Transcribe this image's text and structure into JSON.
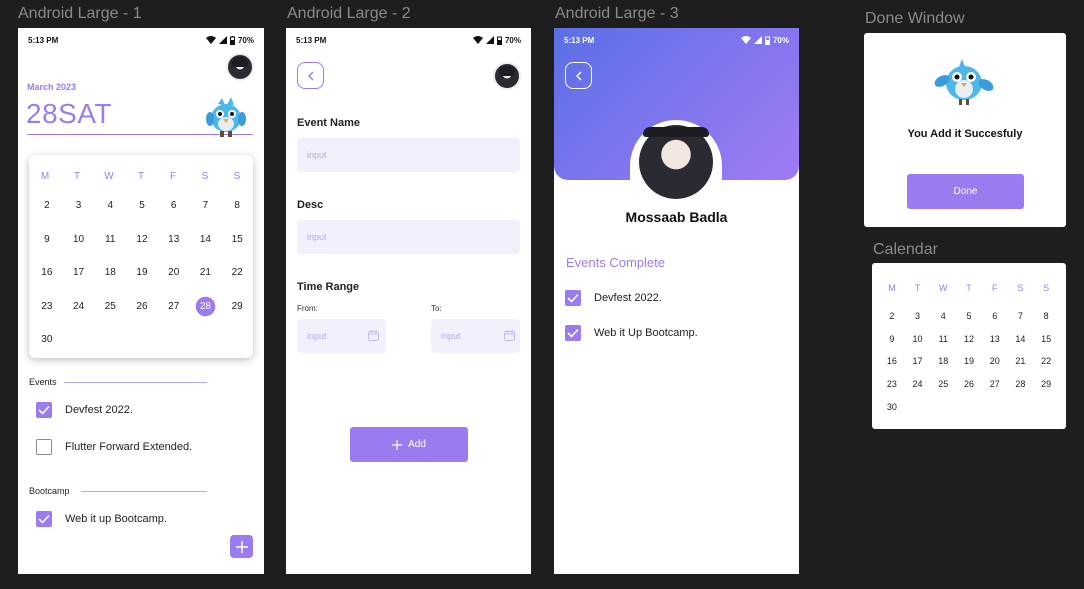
{
  "frames": {
    "f1": "Android Large - 1",
    "f2": "Android Large - 2",
    "f3": "Android Large - 3",
    "done": "Done Window",
    "calendar": "Calendar"
  },
  "status": {
    "time": "5:13 PM",
    "battery": "70%"
  },
  "screen1": {
    "month": "March 2023",
    "date": "28SAT",
    "weekdays": [
      "M",
      "T",
      "W",
      "T",
      "F",
      "S",
      "S"
    ],
    "days": [
      "2",
      "3",
      "4",
      "5",
      "6",
      "7",
      "8",
      "9",
      "10",
      "11",
      "12",
      "13",
      "14",
      "15",
      "16",
      "17",
      "18",
      "19",
      "20",
      "21",
      "22",
      "23",
      "24",
      "25",
      "26",
      "27",
      "28",
      "29",
      "30"
    ],
    "selected_day": "28",
    "events_label": "Events",
    "events": [
      "Devfest 2022.",
      "Flutter Forward Extended."
    ],
    "bootcamp_label": "Bootcamp",
    "bootcamp": [
      "Web it up Bootcamp."
    ]
  },
  "screen2": {
    "event_name_label": "Event Name",
    "event_name_placeholder": "input",
    "desc_label": "Desc",
    "desc_placeholder": "input",
    "time_range_label": "Time Range",
    "from_label": "From:",
    "to_label": "To:",
    "from_placeholder": "input",
    "to_placeholder": "input",
    "add_label": "Add"
  },
  "screen3": {
    "name": "Mossaab Badla",
    "events_complete_label": "Events Complete",
    "completed": [
      "Devfest 2022.",
      "Web it Up Bootcamp."
    ]
  },
  "done_window": {
    "message": "You Add it Succesfuly",
    "button": "Done"
  },
  "calendar_widget": {
    "weekdays": [
      "M",
      "T",
      "W",
      "T",
      "F",
      "S",
      "S"
    ],
    "days": [
      "2",
      "3",
      "4",
      "5",
      "6",
      "7",
      "8",
      "9",
      "10",
      "11",
      "12",
      "13",
      "14",
      "15",
      "16",
      "17",
      "18",
      "19",
      "20",
      "21",
      "22",
      "23",
      "24",
      "25",
      "26",
      "27",
      "28",
      "29",
      "30"
    ]
  },
  "colors": {
    "accent": "#9b7bf0",
    "gradient_start": "#5b6fe6",
    "gradient_end": "#a07bf5",
    "canvas": "#1e1e1e"
  }
}
